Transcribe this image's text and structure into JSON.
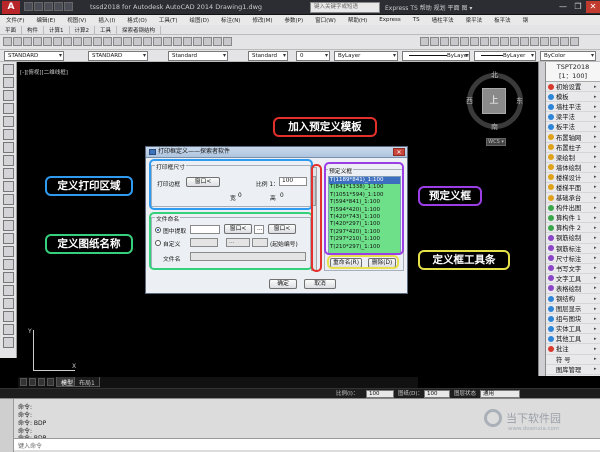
{
  "window": {
    "title": "tssd2018 for Autodesk AutoCAD 2014    Drawing1.dwg",
    "search_placeholder": "键入关键字或短语",
    "right_items": "Express   TS   帮助   规划   平面   图 ▾",
    "controls": [
      "—",
      "❐",
      "✕"
    ]
  },
  "menu": [
    "文件(F)",
    "编辑(E)",
    "视图(V)",
    "插入(I)",
    "格式(O)",
    "工具(T)",
    "绘图(D)",
    "标注(N)",
    "修改(M)",
    "参数(P)",
    "窗口(W)",
    "帮助(H)",
    "Express",
    "TS",
    "墙柱平法",
    "梁平法",
    "板平法",
    "钢"
  ],
  "tool_tabs": [
    "平面",
    "构件",
    "计算1",
    "计算2",
    "工具",
    "探索者钢结构"
  ],
  "toolbar": {
    "style1": "STANDARD",
    "style2": "STANDARD",
    "style3": "Standard",
    "style4": "Standard",
    "layer": "ByLayer",
    "linetype": "ByLayer",
    "lineweight": "ByLayer",
    "plotstyle": "ByColor",
    "workspace": "0"
  },
  "drawing": {
    "viewport_label": "[-][俯视][二维线框]",
    "ucs_x": "X",
    "ucs_y": "Y"
  },
  "viewcube": {
    "north": "北",
    "south": "南",
    "east": "东",
    "west": "西",
    "face": "上",
    "wcs": "WCS ▾"
  },
  "palette": {
    "header1": "TSPT2018",
    "header2": "[1：100]",
    "items": [
      {
        "label": "初始设置",
        "color": "#d93a2e"
      },
      {
        "label": "模板",
        "color": "#2e86d9"
      },
      {
        "label": "墙柱平法",
        "color": "#2e86d9"
      },
      {
        "label": "梁平法",
        "color": "#2e86d9"
      },
      {
        "label": "板平法",
        "color": "#2e86d9"
      },
      {
        "label": "布置轴网",
        "color": "#e0a21a"
      },
      {
        "label": "布置柱子",
        "color": "#e0a21a"
      },
      {
        "label": "梁绘制",
        "color": "#e0a21a"
      },
      {
        "label": "墙体绘制",
        "color": "#e0a21a"
      },
      {
        "label": "楼梯设计",
        "color": "#e0a21a"
      },
      {
        "label": "楼梯平面",
        "color": "#e0a21a"
      },
      {
        "label": "基础承台",
        "color": "#e0a21a"
      },
      {
        "label": "构件出图",
        "color": "#3aa84a"
      },
      {
        "label": "算构件 1",
        "color": "#3aa84a"
      },
      {
        "label": "算构件 2",
        "color": "#3aa84a"
      },
      {
        "label": "钢筋绘制",
        "color": "#8b45c7"
      },
      {
        "label": "钢筋标注",
        "color": "#8b45c7"
      },
      {
        "label": "尺寸标注",
        "color": "#8b45c7"
      },
      {
        "label": "书写文字",
        "color": "#8b45c7"
      },
      {
        "label": "文字工具",
        "color": "#8b45c7"
      },
      {
        "label": "表格绘制",
        "color": "#8b45c7"
      },
      {
        "label": "钢结构",
        "color": "#2e86d9"
      },
      {
        "label": "图层显示",
        "color": "#2e86d9"
      },
      {
        "label": "组与图块",
        "color": "#2e86d9"
      },
      {
        "label": "实体工具",
        "color": "#2e86d9"
      },
      {
        "label": "其他工具",
        "color": "#2e86d9"
      },
      {
        "label": "批注",
        "color": "#d93a2e"
      },
      {
        "label": "符 号",
        "color": "#e9e9ec"
      },
      {
        "label": "图库管理",
        "color": "#e9e9ec"
      }
    ]
  },
  "tabs": [
    "模型",
    "布局1"
  ],
  "status": {
    "scale_label": "比例(I)：",
    "scale_value": "100",
    "drawing_label": "图纸(D)：",
    "drawing_value": "100",
    "state_label": "图层状态",
    "state_value": "通用"
  },
  "command": {
    "lines": [
      "命令:",
      "命令:",
      "命令: BDP",
      "命令:",
      "命令: BDP"
    ],
    "input_placeholder": "键入命令"
  },
  "watermark": {
    "text": "当下软件园",
    "url": "www.downxia.com"
  },
  "dialog": {
    "title": "打印框定义——探索者软件",
    "close": "✕",
    "print_size_group": "打印框尺寸",
    "print_border_label": "打印边框",
    "window_btn": "窗口<",
    "scale_label": "比例 1：",
    "scale_value": "100",
    "width_label": "宽",
    "width_value": "0",
    "height_label": "高",
    "height_value": "0",
    "filename_group": "文件命名",
    "opt_extract": "图中提取",
    "opt_custom": "自定义",
    "window_btn2": "窗口<",
    "window_btn3": "窗口<",
    "dots1": "...",
    "dots2": "...",
    "start_number": "(起始编号)",
    "filename_label": "文件名",
    "preset_group": "预定义框",
    "presets": [
      "T(1189*841)_1:100",
      "T(841*1338)_1:100",
      "T(1051*594)_1:100",
      "T(594*841)_1:100",
      "T(594*420)_1:100",
      "T(420*743)_1:100",
      "T(420*297)_1:100",
      "T(297*420)_1:100",
      "T(297*210)_1:100",
      "T(210*297)_1:100"
    ],
    "rename_btn": "重命名(R)",
    "delete_btn": "删除(D)",
    "ok_btn": "确定",
    "cancel_btn": "取消"
  },
  "annotations": {
    "print_area": "定义打印区域",
    "sheet_name": "定义图纸名称",
    "add_template": "加入预定义模板",
    "preset_frame": "预定义框",
    "frame_tools": "定义框工具条"
  },
  "colors": {
    "annotation_blue": "#2f9bf0",
    "annotation_green": "#35d07b",
    "annotation_red": "#e3302b",
    "annotation_purple": "#9b3ee6",
    "annotation_yellow": "#e8e04a",
    "preset_fill": "#6fe08a"
  }
}
